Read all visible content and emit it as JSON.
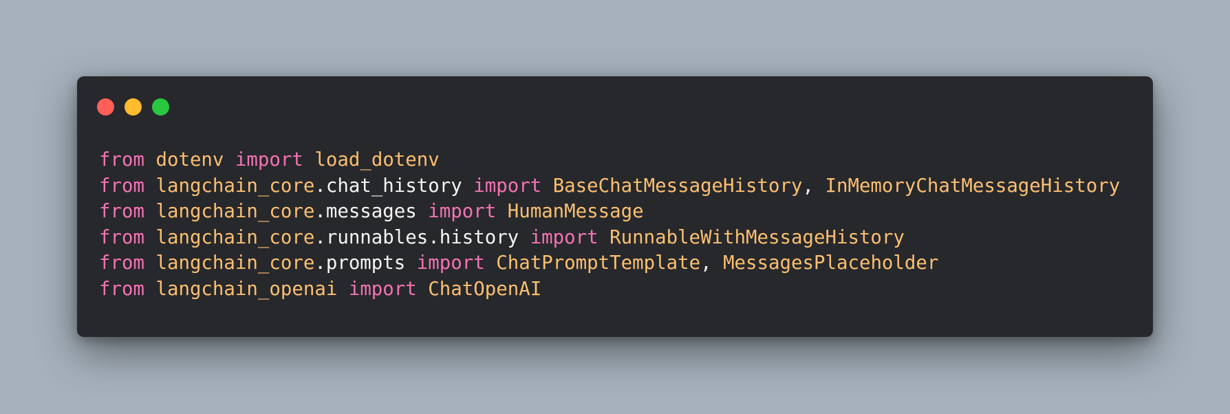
{
  "window": {
    "controls": {
      "close_color": "#ff5f57",
      "minimize_color": "#febc2e",
      "maximize_color": "#28c840"
    }
  },
  "code": {
    "lines": [
      {
        "kw_from": "from",
        "module_root": "dotenv",
        "module_rest": "",
        "kw_import": "import",
        "names": [
          "load_dotenv"
        ]
      },
      {
        "kw_from": "from",
        "module_root": "langchain_core",
        "module_rest": ".chat_history",
        "kw_import": "import",
        "names": [
          "BaseChatMessageHistory",
          "InMemoryChatMessageHistory"
        ]
      },
      {
        "kw_from": "from",
        "module_root": "langchain_core",
        "module_rest": ".messages",
        "kw_import": "import",
        "names": [
          "HumanMessage"
        ]
      },
      {
        "kw_from": "from",
        "module_root": "langchain_core",
        "module_rest": ".runnables.history",
        "kw_import": "import",
        "names": [
          "RunnableWithMessageHistory"
        ]
      },
      {
        "kw_from": "from",
        "module_root": "langchain_core",
        "module_rest": ".prompts",
        "kw_import": "import",
        "names": [
          "ChatPromptTemplate",
          "MessagesPlaceholder"
        ]
      },
      {
        "kw_from": "from",
        "module_root": "langchain_openai",
        "module_rest": "",
        "kw_import": "import",
        "names": [
          "ChatOpenAI"
        ]
      }
    ]
  }
}
